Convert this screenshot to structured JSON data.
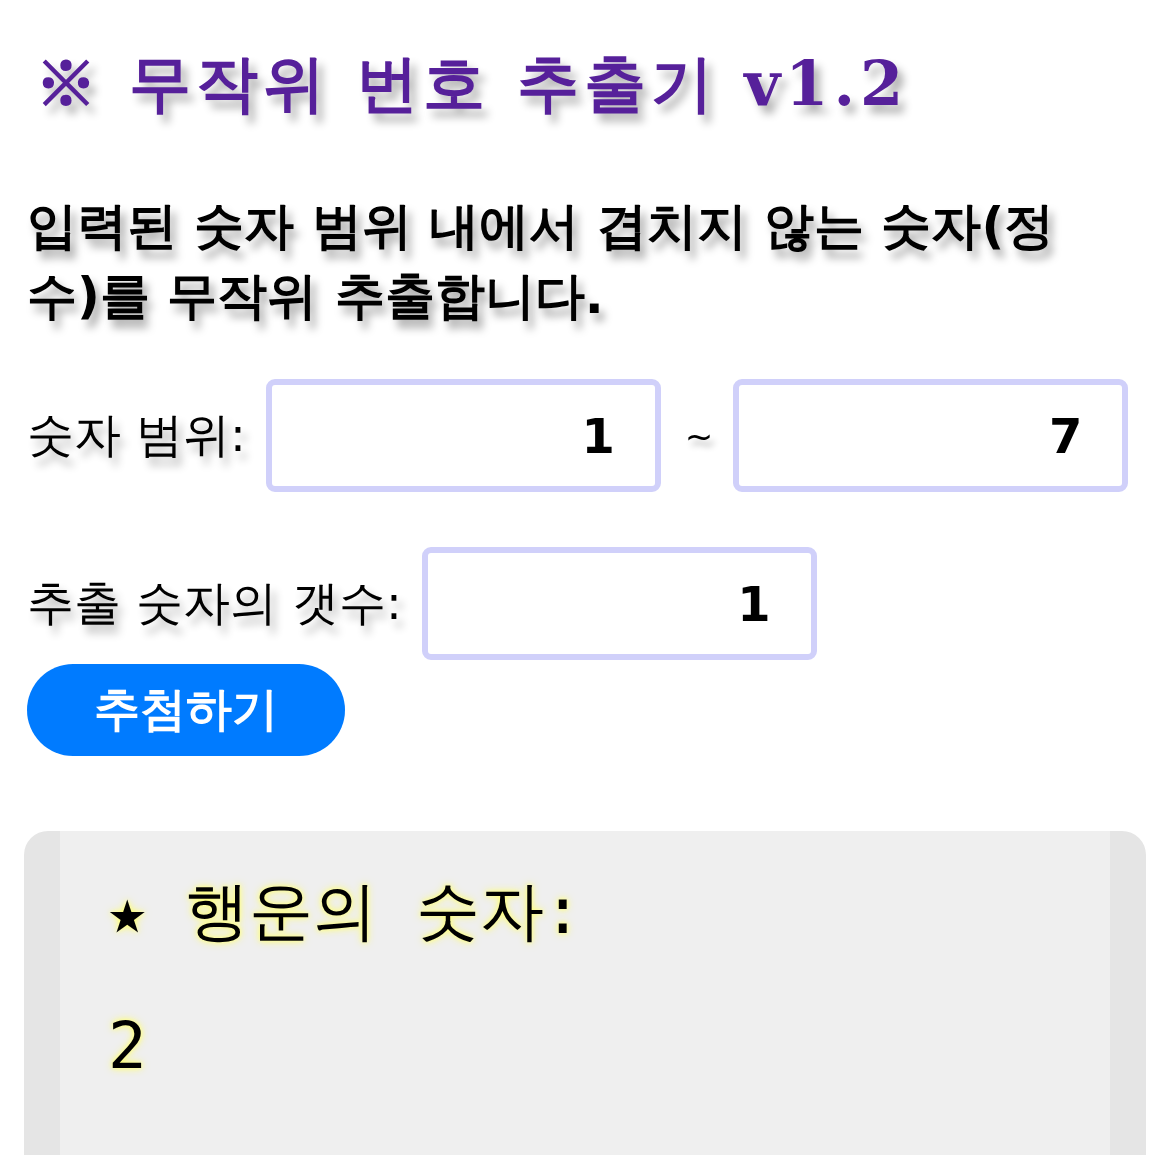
{
  "title": "※ 무작위 번호 추출기 v1.2",
  "description": "입력된 숫자 범위 내에서 겹치지 않는 숫자(정수)를 무작위 추출합니다.",
  "range": {
    "label": "숫자 범위:",
    "from": {
      "value": "1"
    },
    "separator": "~",
    "to": {
      "value": "7"
    }
  },
  "count": {
    "label": "추출 숫자의 갯수:",
    "value": "1"
  },
  "draw_button": {
    "label": "추첨하기"
  },
  "result": {
    "heading": "★ 행운의 숫자:",
    "numbers": "2"
  }
}
